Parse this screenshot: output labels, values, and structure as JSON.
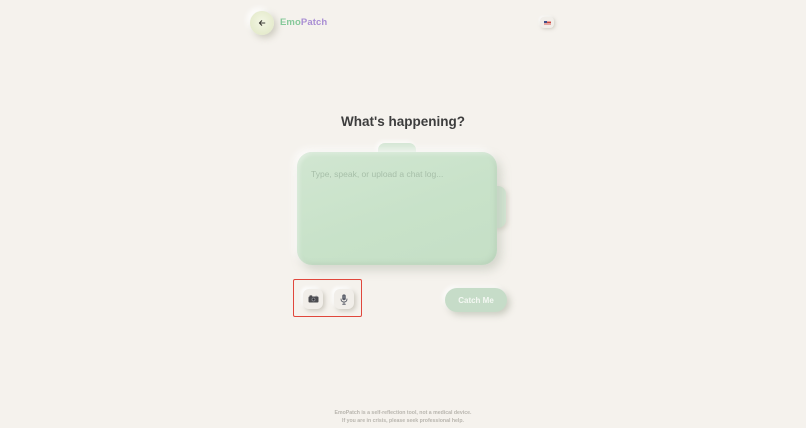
{
  "header": {
    "back_icon": "arrow-left-icon",
    "brand_part1": "Emo",
    "brand_part2": "Patch",
    "language_icon": "us-flag-icon"
  },
  "main": {
    "heading": "What's happening?",
    "input_placeholder": "Type, speak, or upload a chat log...",
    "input_value": "",
    "camera_icon": "camera-icon",
    "mic_icon": "microphone-icon",
    "submit_label": "Catch Me"
  },
  "footer": {
    "line1": "EmoPatch is a self-reflection tool, not a medical device.",
    "line2": "If you are in crisis, please seek professional help."
  },
  "colors": {
    "background": "#f5f2ed",
    "brand_emo": "#86c99a",
    "brand_patch": "#a98ed4",
    "card": "#c8e2c9",
    "button": "#c6dcc8",
    "highlight": "#e0473c"
  }
}
